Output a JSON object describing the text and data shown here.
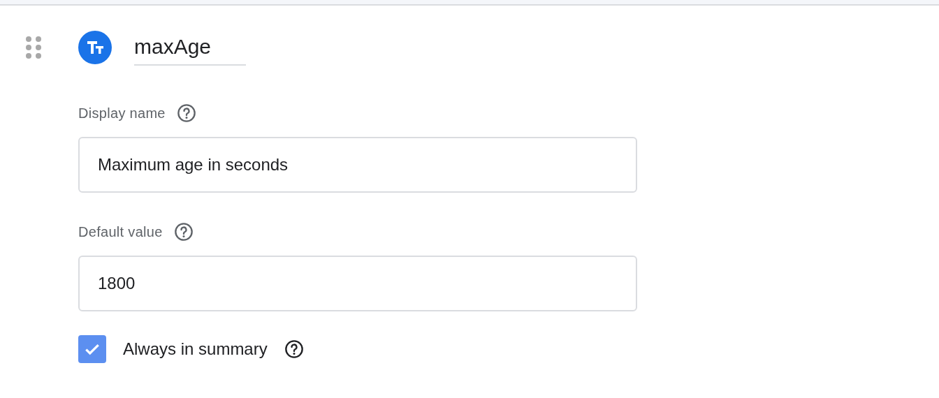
{
  "parameter": {
    "name": "maxAge",
    "fields": [
      {
        "label": "Display name",
        "value": "Maximum age in seconds"
      },
      {
        "label": "Default value",
        "value": "1800"
      }
    ],
    "always_in_summary": {
      "label": "Always in summary",
      "checked": true
    }
  }
}
